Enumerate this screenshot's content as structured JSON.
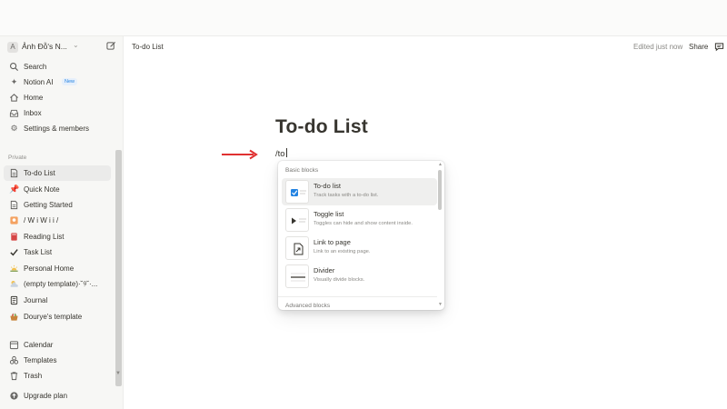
{
  "workspace": {
    "avatar": "A",
    "name": "Ảnh Đỗ's N..."
  },
  "nav": [
    {
      "label": "Search",
      "icon": "search-icon"
    },
    {
      "label": "Notion AI",
      "icon": "sparkle-icon",
      "badge": "New"
    },
    {
      "label": "Home",
      "icon": "home-icon"
    },
    {
      "label": "Inbox",
      "icon": "inbox-icon"
    },
    {
      "label": "Settings & members",
      "icon": "gear-icon"
    }
  ],
  "private_label": "Private",
  "pages": [
    {
      "label": "To-do List",
      "icon": "page-icon"
    },
    {
      "label": "Quick Note",
      "icon": "pushpin-icon"
    },
    {
      "label": "Getting Started",
      "icon": "page-icon"
    },
    {
      "label": "/ W i W i i /",
      "icon": "picture-icon"
    },
    {
      "label": "Reading List",
      "icon": "book-icon"
    },
    {
      "label": "Task List",
      "icon": "checkmark-icon"
    },
    {
      "label": "Personal Home",
      "icon": "sunrise-icon"
    },
    {
      "label": "(empty template)·˘୨˘·...",
      "icon": "cloud-icon"
    },
    {
      "label": "Journal",
      "icon": "journal-icon"
    },
    {
      "label": "Dourye's template",
      "icon": "basket-icon"
    }
  ],
  "bottom_nav": [
    {
      "label": "Calendar",
      "icon": "calendar-icon"
    },
    {
      "label": "Templates",
      "icon": "templates-icon"
    },
    {
      "label": "Trash",
      "icon": "trash-icon"
    }
  ],
  "upgrade": {
    "label": "Upgrade plan",
    "icon": "upgrade-icon"
  },
  "header": {
    "breadcrumb": "To-do List",
    "edited": "Edited just now",
    "share": "Share"
  },
  "doc": {
    "title": "To-do List",
    "command": "/to"
  },
  "menu": {
    "section": "Basic blocks",
    "items": [
      {
        "title": "To-do list",
        "desc": "Track tasks with a to-do list.",
        "icon": "checkbox-icon"
      },
      {
        "title": "Toggle list",
        "desc": "Toggles can hide and show content inside.",
        "icon": "toggle-icon"
      },
      {
        "title": "Link to page",
        "desc": "Link to an existing page.",
        "icon": "link-page-icon"
      },
      {
        "title": "Divider",
        "desc": "Visually divide blocks.",
        "icon": "divider-icon"
      }
    ],
    "footer_section": "Advanced blocks"
  },
  "colors": {
    "accent": "#2383e2",
    "arrow": "#e03131",
    "sidebar_bg": "#f7f7f5"
  }
}
